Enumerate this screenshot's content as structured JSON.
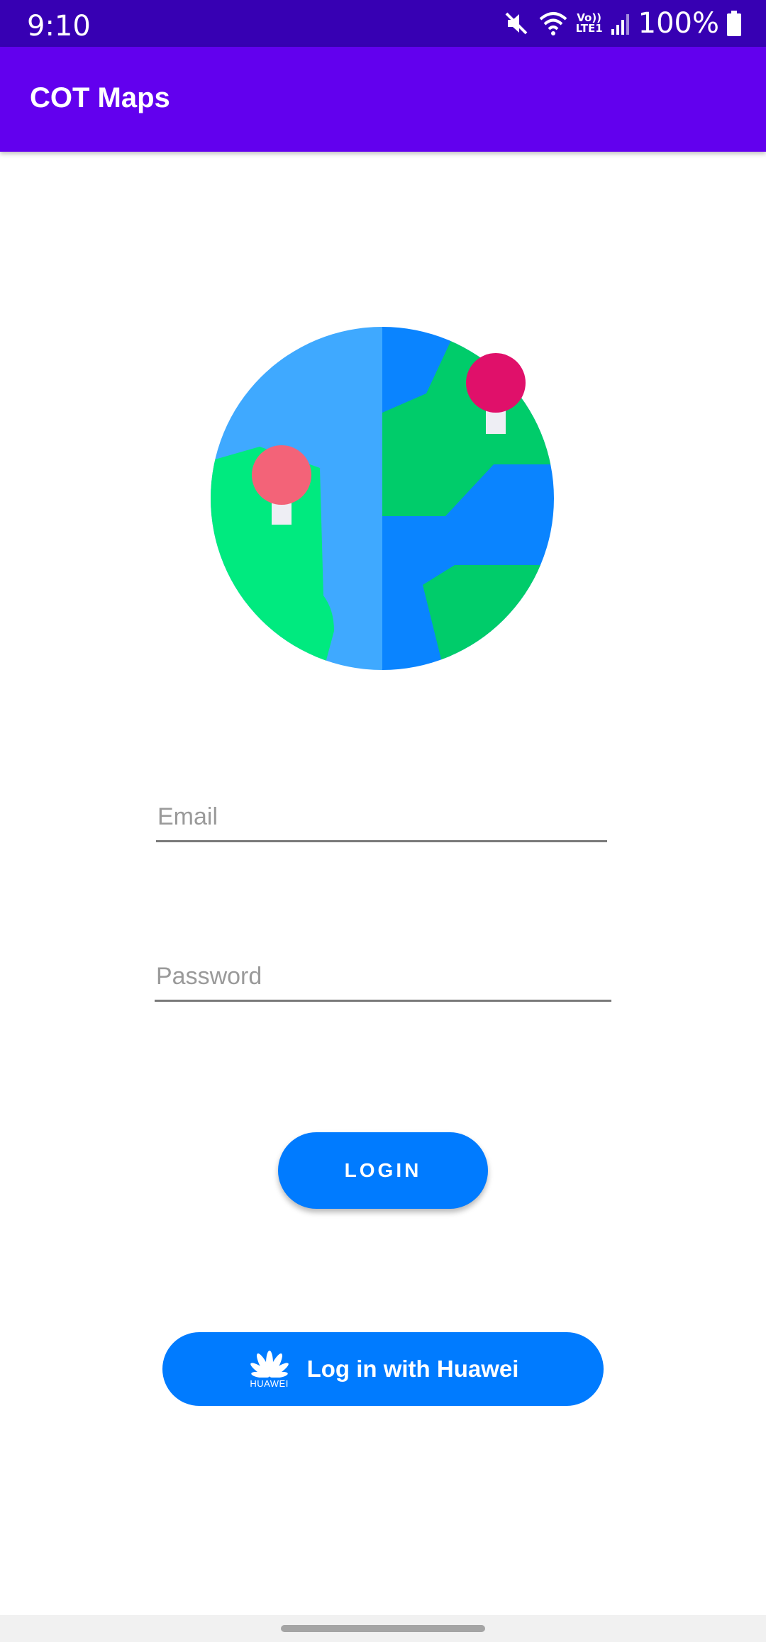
{
  "status_bar": {
    "time": "9:10",
    "battery_text": "100%",
    "icons": [
      "mute-icon",
      "wifi-icon",
      "volte-icon",
      "signal-icon",
      "battery-icon"
    ],
    "volte_text_top": "Vo))",
    "volte_text_bottom": "LTE1"
  },
  "app_bar": {
    "title": "COT Maps",
    "color": "#6200ee"
  },
  "hero": {
    "icon": "globe-map-pins-icon",
    "colors": {
      "water_light": "#3fa9ff",
      "water_dark": "#0a84ff",
      "land_green": "#00cc6a",
      "land_mint": "#00ea7f",
      "pin_magenta": "#e0106a",
      "pin_pink": "#f36378",
      "pin_stem": "#eeeef4"
    }
  },
  "form": {
    "email": {
      "placeholder": "Email",
      "value": ""
    },
    "password": {
      "placeholder": "Password",
      "value": ""
    }
  },
  "login_button": {
    "label": "LOGIN",
    "color": "#007bff"
  },
  "huawei_button": {
    "label": "Log in with Huawei",
    "logo_text": "HUAWEI",
    "icon": "huawei-logo-icon"
  }
}
